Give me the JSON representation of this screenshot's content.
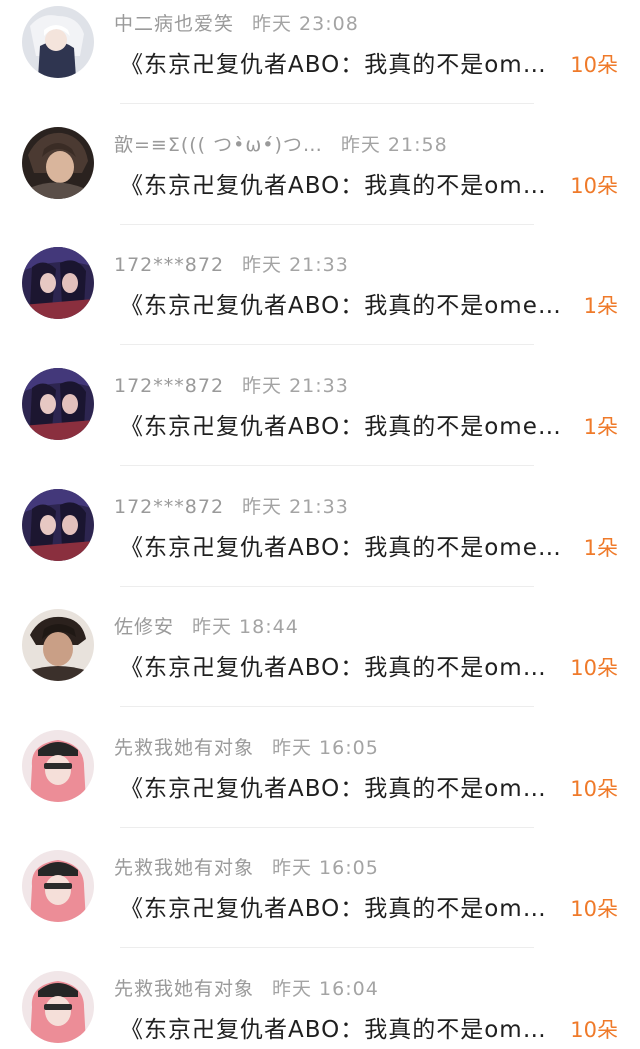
{
  "items": [
    {
      "name": "中二病也爱笑",
      "time": "昨天 23:08",
      "message": "《东京卍复仇者ABO：我真的不是om…",
      "count": "10朵",
      "avatar": "avatar-white-hair-icon",
      "avatar_color": "#cfd3dc"
    },
    {
      "name": "歆=≡Σ((( つ•̀ω•́)つ…",
      "time": "昨天 21:58",
      "message": "《东京卍复仇者ABO：我真的不是om…",
      "count": "10朵",
      "avatar": "avatar-dark-hair-icon",
      "avatar_color": "#4a3c36"
    },
    {
      "name": "172***872",
      "time": "昨天 21:33",
      "message": "《东京卍复仇者ABO：我真的不是ome…",
      "count": "1朵",
      "avatar": "avatar-couple-art-icon",
      "avatar_color": "#3b3060"
    },
    {
      "name": "172***872",
      "time": "昨天 21:33",
      "message": "《东京卍复仇者ABO：我真的不是ome…",
      "count": "1朵",
      "avatar": "avatar-couple-art-icon",
      "avatar_color": "#3b3060"
    },
    {
      "name": "172***872",
      "time": "昨天 21:33",
      "message": "《东京卍复仇者ABO：我真的不是ome…",
      "count": "1朵",
      "avatar": "avatar-couple-art-icon",
      "avatar_color": "#3b3060"
    },
    {
      "name": "佐修安",
      "time": "昨天 18:44",
      "message": "《东京卍复仇者ABO：我真的不是om…",
      "count": "10朵",
      "avatar": "avatar-man-portrait-icon",
      "avatar_color": "#5a4a40"
    },
    {
      "name": "先救我她有对象",
      "time": "昨天 16:05",
      "message": "《东京卍复仇者ABO：我真的不是om…",
      "count": "10朵",
      "avatar": "avatar-pink-hair-icon",
      "avatar_color": "#e8b8bc"
    },
    {
      "name": "先救我她有对象",
      "time": "昨天 16:05",
      "message": "《东京卍复仇者ABO：我真的不是om…",
      "count": "10朵",
      "avatar": "avatar-pink-hair-icon",
      "avatar_color": "#e8b8bc"
    },
    {
      "name": "先救我她有对象",
      "time": "昨天 16:04",
      "message": "《东京卍复仇者ABO：我真的不是om…",
      "count": "10朵",
      "avatar": "avatar-pink-hair-icon",
      "avatar_color": "#e8b8bc"
    }
  ]
}
